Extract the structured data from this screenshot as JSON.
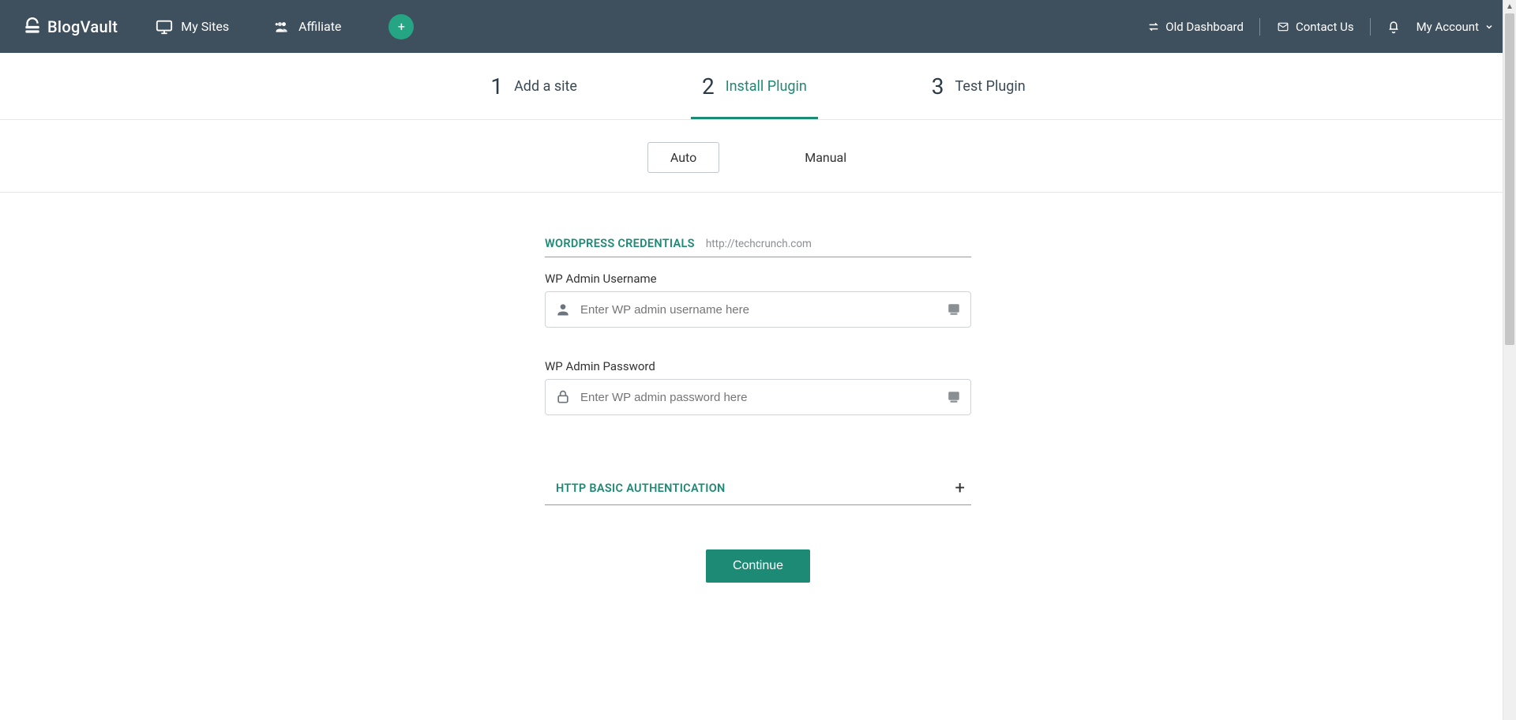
{
  "brand": {
    "name": "BlogVault"
  },
  "nav": {
    "mysites": "My Sites",
    "affiliate": "Affiliate"
  },
  "headerRight": {
    "oldDashboard": "Old Dashboard",
    "contactUs": "Contact Us",
    "myAccount": "My Account"
  },
  "steps": [
    {
      "num": "1",
      "label": "Add a site"
    },
    {
      "num": "2",
      "label": "Install Plugin"
    },
    {
      "num": "3",
      "label": "Test Plugin"
    }
  ],
  "modes": {
    "auto": "Auto",
    "manual": "Manual"
  },
  "credentials": {
    "title": "WORDPRESS CREDENTIALS",
    "siteUrl": "http://techcrunch.com",
    "usernameLabel": "WP Admin Username",
    "usernamePlaceholder": "Enter WP admin username here",
    "passwordLabel": "WP Admin Password",
    "passwordPlaceholder": "Enter WP admin password here"
  },
  "httpAuth": {
    "title": "HTTP BASIC AUTHENTICATION"
  },
  "buttons": {
    "continue": "Continue"
  }
}
